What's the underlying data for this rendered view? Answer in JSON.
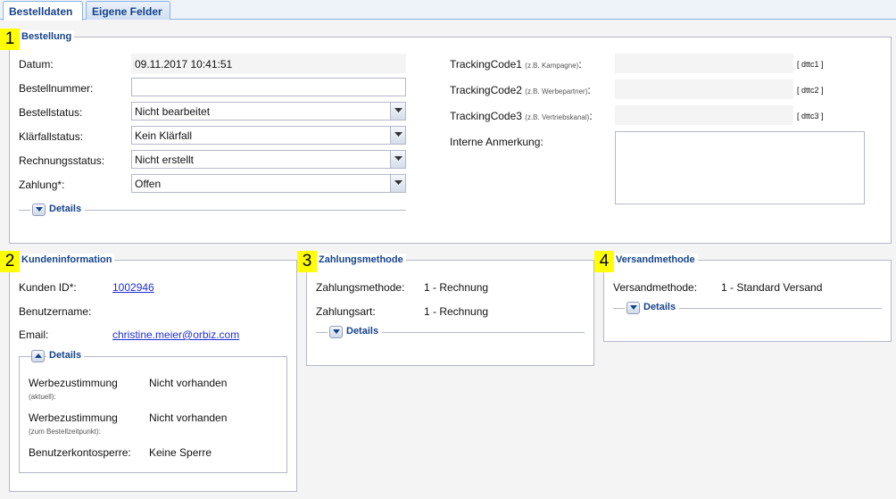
{
  "tabs": [
    {
      "label": "Bestelldaten",
      "active": true
    },
    {
      "label": "Eigene Felder",
      "active": false
    }
  ],
  "markers": [
    "1",
    "2",
    "3",
    "4"
  ],
  "bestellung": {
    "legend": "Bestellung",
    "datum_label": "Datum:",
    "datum_value": "09.11.2017 10:41:51",
    "bestellnummer_label": "Bestellnummer:",
    "bestellnummer_value": "",
    "bestellstatus_label": "Bestellstatus:",
    "bestellstatus_value": "Nicht bearbeitet",
    "klaerfall_label": "Klärfallstatus:",
    "klaerfall_value": "Kein Klärfall",
    "rechnung_label": "Rechnungsstatus:",
    "rechnung_value": "Nicht erstellt",
    "zahlung_label": "Zahlung*:",
    "zahlung_value": "Offen",
    "details_label": "Details",
    "tracking": [
      {
        "label": "TrackingCode1",
        "hint": "(z.B. Kampagne)",
        "colon": ":",
        "code": "[ dttc1 ]"
      },
      {
        "label": "TrackingCode2",
        "hint": "(z.B. Werbepartner)",
        "colon": ":",
        "code": "[ dttc2 ]"
      },
      {
        "label": "TrackingCode3",
        "hint": "(z.B. Vertriebskanal)",
        "colon": ":",
        "code": "[ dttc3 ]"
      }
    ],
    "anmerkung_label": "Interne Anmerkung:"
  },
  "kunde": {
    "legend": "Kundeninformation",
    "kunden_id_label": "Kunden ID*:",
    "kunden_id_value": "1002946",
    "benutzername_label": "Benutzername:",
    "email_label": "Email:",
    "email_value": "christine.meier@orbiz.com",
    "details_label": "Details",
    "werbe1_label": "Werbezustimmung",
    "werbe1_hint": "(aktuell)",
    "werbe1_value": "Nicht vorhanden",
    "werbe2_label": "Werbezustimmung",
    "werbe2_hint": "(zum Bestellzeitpunkt)",
    "werbe2_value": "Nicht vorhanden",
    "sperre_label": "Benutzerkontosperre:",
    "sperre_value": "Keine Sperre"
  },
  "zahlungsmethode": {
    "legend": "Zahlungsmethode",
    "methode_label": "Zahlungsmethode:",
    "methode_value": "1 - Rechnung",
    "art_label": "Zahlungsart:",
    "art_value": "1 - Rechnung",
    "details_label": "Details"
  },
  "versandmethode": {
    "legend": "Versandmethode",
    "methode_label": "Versandmethode:",
    "methode_value": "1 - Standard Versand",
    "details_label": "Details"
  },
  "colors": {
    "accent": "#15428b",
    "border": "#b5b8c8",
    "marker": "#ffff00",
    "link": "#1f2ed6"
  }
}
